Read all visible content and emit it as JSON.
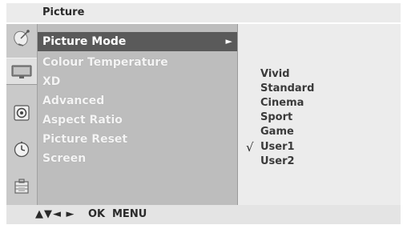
{
  "title": "Picture",
  "menu": {
    "items": [
      {
        "label": "Picture Mode",
        "arrow": "►"
      },
      {
        "label": "Colour Temperature"
      },
      {
        "label": "XD"
      },
      {
        "label": "Advanced"
      },
      {
        "label": "Aspect Ratio"
      },
      {
        "label": "Picture Reset"
      },
      {
        "label": "Screen"
      }
    ]
  },
  "submenu": {
    "options": [
      "Vivid",
      "Standard",
      "Cinema",
      "Sport",
      "Game",
      "User1",
      "User2"
    ],
    "check_mark": "√"
  },
  "footer": {
    "nav_arrows": "▲▼◄ ►",
    "ok": "OK",
    "menu": "MENU"
  },
  "sidebar": {
    "icons": [
      "satellite-dish-icon",
      "tv-screen-icon",
      "speaker-icon",
      "clock-icon",
      "lock-icon"
    ]
  },
  "colors": {
    "selected_bg": "#5a5a5a",
    "menu_bg": "#bdbdbd",
    "submenu_bg": "#ececec"
  }
}
